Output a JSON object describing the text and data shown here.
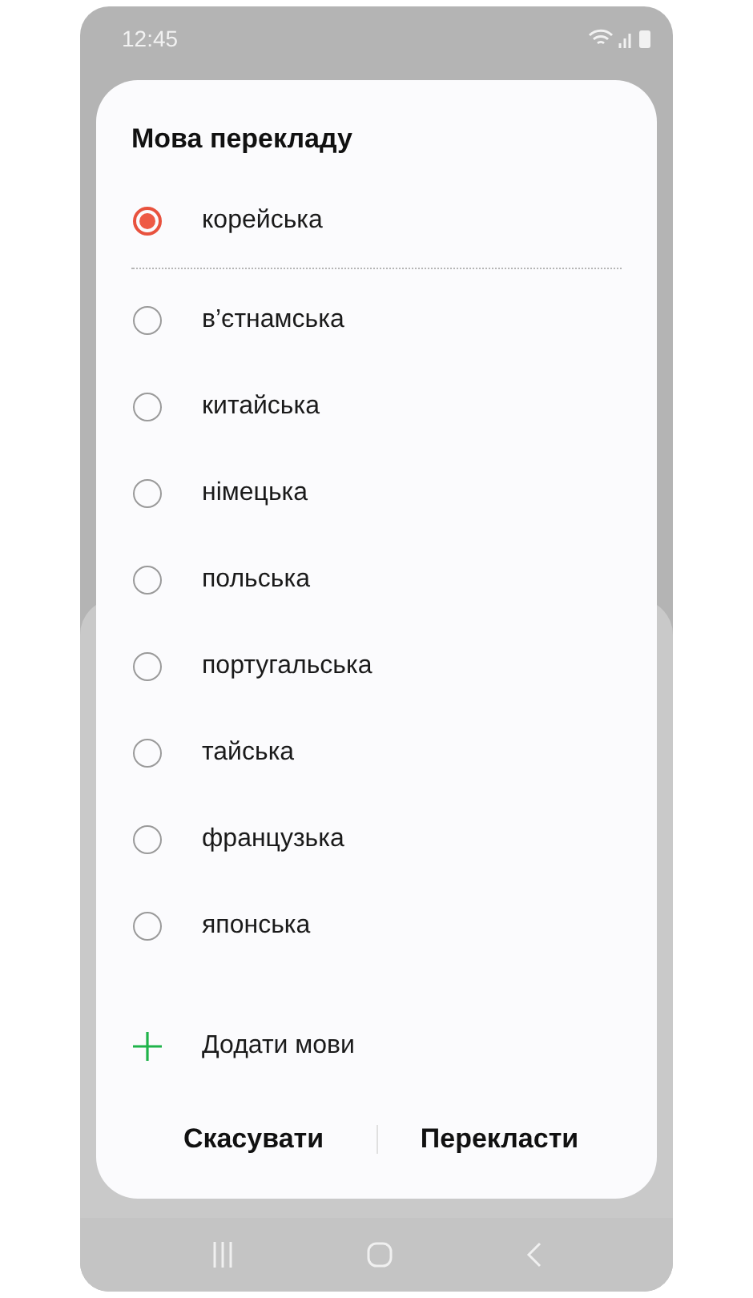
{
  "status_bar": {
    "time": "12:45"
  },
  "dialog": {
    "title": "Мова перекладу",
    "languages": [
      {
        "label": "корейська",
        "selected": true
      },
      {
        "label": "в’єтнамська",
        "selected": false
      },
      {
        "label": "китайська",
        "selected": false
      },
      {
        "label": "німецька",
        "selected": false
      },
      {
        "label": "польська",
        "selected": false
      },
      {
        "label": "португальська",
        "selected": false
      },
      {
        "label": "тайська",
        "selected": false
      },
      {
        "label": "французька",
        "selected": false
      },
      {
        "label": "японська",
        "selected": false
      }
    ],
    "add_button": "Додати мови",
    "buttons": [
      "Скасувати",
      "Перекласти"
    ]
  }
}
